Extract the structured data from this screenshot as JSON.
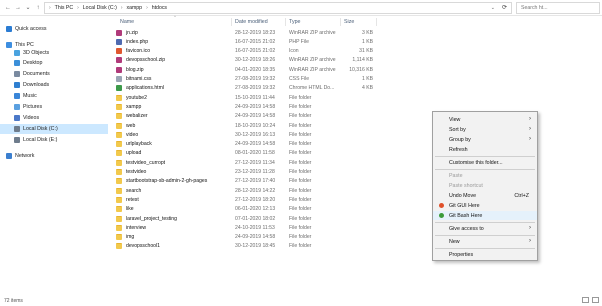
{
  "toolbar": {
    "back_glyph": "←",
    "forward_glyph": "→",
    "dropdown_glyph": "⌄",
    "up_glyph": "↑",
    "refresh_glyph": "⟳"
  },
  "breadcrumb": {
    "root_glyph": "›",
    "items": [
      "This PC",
      "Local Disk (C:)",
      "xampp",
      "htdocs"
    ],
    "separator": "›"
  },
  "search": {
    "placeholder": "Search ht..."
  },
  "nav": {
    "items": [
      {
        "label": "Quick access",
        "icon": "star-icon",
        "color": "#2b7cd3"
      },
      {
        "label": "This PC",
        "icon": "computer-icon",
        "color": "#3d8ee0"
      },
      {
        "label": "3D Objects",
        "icon": "cube-icon",
        "color": "#4aa3df"
      },
      {
        "label": "Desktop",
        "icon": "desktop-icon",
        "color": "#3b8fd9"
      },
      {
        "label": "Documents",
        "icon": "documents-icon",
        "color": "#7a8aa0"
      },
      {
        "label": "Downloads",
        "icon": "download-icon",
        "color": "#2f7fd0"
      },
      {
        "label": "Music",
        "icon": "music-icon",
        "color": "#3a86d8"
      },
      {
        "label": "Pictures",
        "icon": "pictures-icon",
        "color": "#5aa0e0"
      },
      {
        "label": "Videos",
        "icon": "videos-icon",
        "color": "#4b78c8"
      },
      {
        "label": "Local Disk (C:)",
        "icon": "drive-icon",
        "color": "#6e7c8c"
      },
      {
        "label": "Local Disk (E:)",
        "icon": "drive-icon",
        "color": "#6e7c8c"
      },
      {
        "label": "Network",
        "icon": "network-icon",
        "color": "#3b7fcf"
      }
    ],
    "selected_index": 9,
    "selection_color": "#cce8ff"
  },
  "list": {
    "headers": {
      "name": "Name",
      "date": "Date modified",
      "type": "Type",
      "size": "Size"
    },
    "sort_glyph": "^",
    "files": [
      {
        "name": "jn.zip",
        "date": "28-12-2019 18:23",
        "type": "WinRAR ZIP archive",
        "size": "3 KB",
        "icon": "zip-icon",
        "color": "#b03a7a"
      },
      {
        "name": "index.php",
        "date": "16-07-2015 21:02",
        "type": "PHP File",
        "size": "1 KB",
        "icon": "php-file-icon",
        "color": "#4f6ab0"
      },
      {
        "name": "favicon.ico",
        "date": "16-07-2015 21:02",
        "type": "Icon",
        "size": "31 KB",
        "icon": "ico-file-icon",
        "color": "#e0572f"
      },
      {
        "name": "devopsschool.zip",
        "date": "30-12-2019 18:26",
        "type": "WinRAR ZIP archive",
        "size": "1,114 KB",
        "icon": "zip-icon",
        "color": "#b03a7a"
      },
      {
        "name": "blog.zip",
        "date": "04-01-2020 18:35",
        "type": "WinRAR ZIP archive",
        "size": "10,316 KB",
        "icon": "zip-icon",
        "color": "#b03a7a"
      },
      {
        "name": "bitnami.css",
        "date": "27-08-2019 19:32",
        "type": "CSS File",
        "size": "1 KB",
        "icon": "css-file-icon",
        "color": "#9aa5b4"
      },
      {
        "name": "applications.html",
        "date": "27-08-2019 19:32",
        "type": "Chrome HTML Do...",
        "size": "4 KB",
        "icon": "chrome-icon",
        "color": "#3c9a4a"
      }
    ],
    "folders": [
      {
        "name": "youtube2",
        "date": "15-10-2019 11:44",
        "type": "File folder"
      },
      {
        "name": "xampp",
        "date": "24-09-2019 14:58",
        "type": "File folder"
      },
      {
        "name": "webalizer",
        "date": "24-09-2019 14:58",
        "type": "File folder"
      },
      {
        "name": "web",
        "date": "18-10-2019 10:24",
        "type": "File folder"
      },
      {
        "name": "video",
        "date": "30-12-2019 16:13",
        "type": "File folder"
      },
      {
        "name": "urlplayback",
        "date": "24-09-2019 14:58",
        "type": "File folder"
      },
      {
        "name": "upload",
        "date": "08-01-2020 11:58",
        "type": "File folder"
      },
      {
        "name": "testvideo_curropt",
        "date": "27-12-2019 11:34",
        "type": "File folder"
      },
      {
        "name": "testvideo",
        "date": "23-12-2019 11:28",
        "type": "File folder"
      },
      {
        "name": "startbootstrap-sb-admin-2-gh-pages",
        "date": "27-12-2019 17:40",
        "type": "File folder"
      },
      {
        "name": "search",
        "date": "28-12-2019 14:22",
        "type": "File folder"
      },
      {
        "name": "retest",
        "date": "27-12-2019 18:20",
        "type": "File folder"
      },
      {
        "name": "like",
        "date": "06-01-2020 12:13",
        "type": "File folder"
      },
      {
        "name": "laravel_project_testing",
        "date": "07-01-2020 18:02",
        "type": "File folder"
      },
      {
        "name": "interview",
        "date": "24-10-2019 11:53",
        "type": "File folder"
      },
      {
        "name": "img",
        "date": "24-09-2019 14:58",
        "type": "File folder"
      },
      {
        "name": "devopsschool1",
        "date": "30-12-2019 18:45",
        "type": "File folder"
      }
    ]
  },
  "status": {
    "text": "72 items"
  },
  "context_menu": {
    "items": [
      {
        "label": "View",
        "arrow": "›"
      },
      {
        "label": "Sort by",
        "arrow": "›"
      },
      {
        "label": "Group by",
        "arrow": "›"
      },
      {
        "label": "Refresh"
      },
      {
        "sep": true
      },
      {
        "label": "Customise this folder..."
      },
      {
        "sep": true
      },
      {
        "label": "Paste",
        "disabled": true
      },
      {
        "label": "Paste shortcut",
        "disabled": true
      },
      {
        "label": "Undo Move",
        "shortcut": "Ctrl+Z"
      },
      {
        "label": "Git GUI Here",
        "icon": "git-gui-icon",
        "color": "#e0502a"
      },
      {
        "label": "Git Bash Here",
        "icon": "git-bash-icon",
        "color": "#3a9a3a",
        "highlight": true
      },
      {
        "sep": true
      },
      {
        "label": "Give access to",
        "arrow": "›"
      },
      {
        "sep": true
      },
      {
        "label": "New",
        "arrow": "›"
      },
      {
        "sep": true
      },
      {
        "label": "Properties"
      }
    ]
  }
}
